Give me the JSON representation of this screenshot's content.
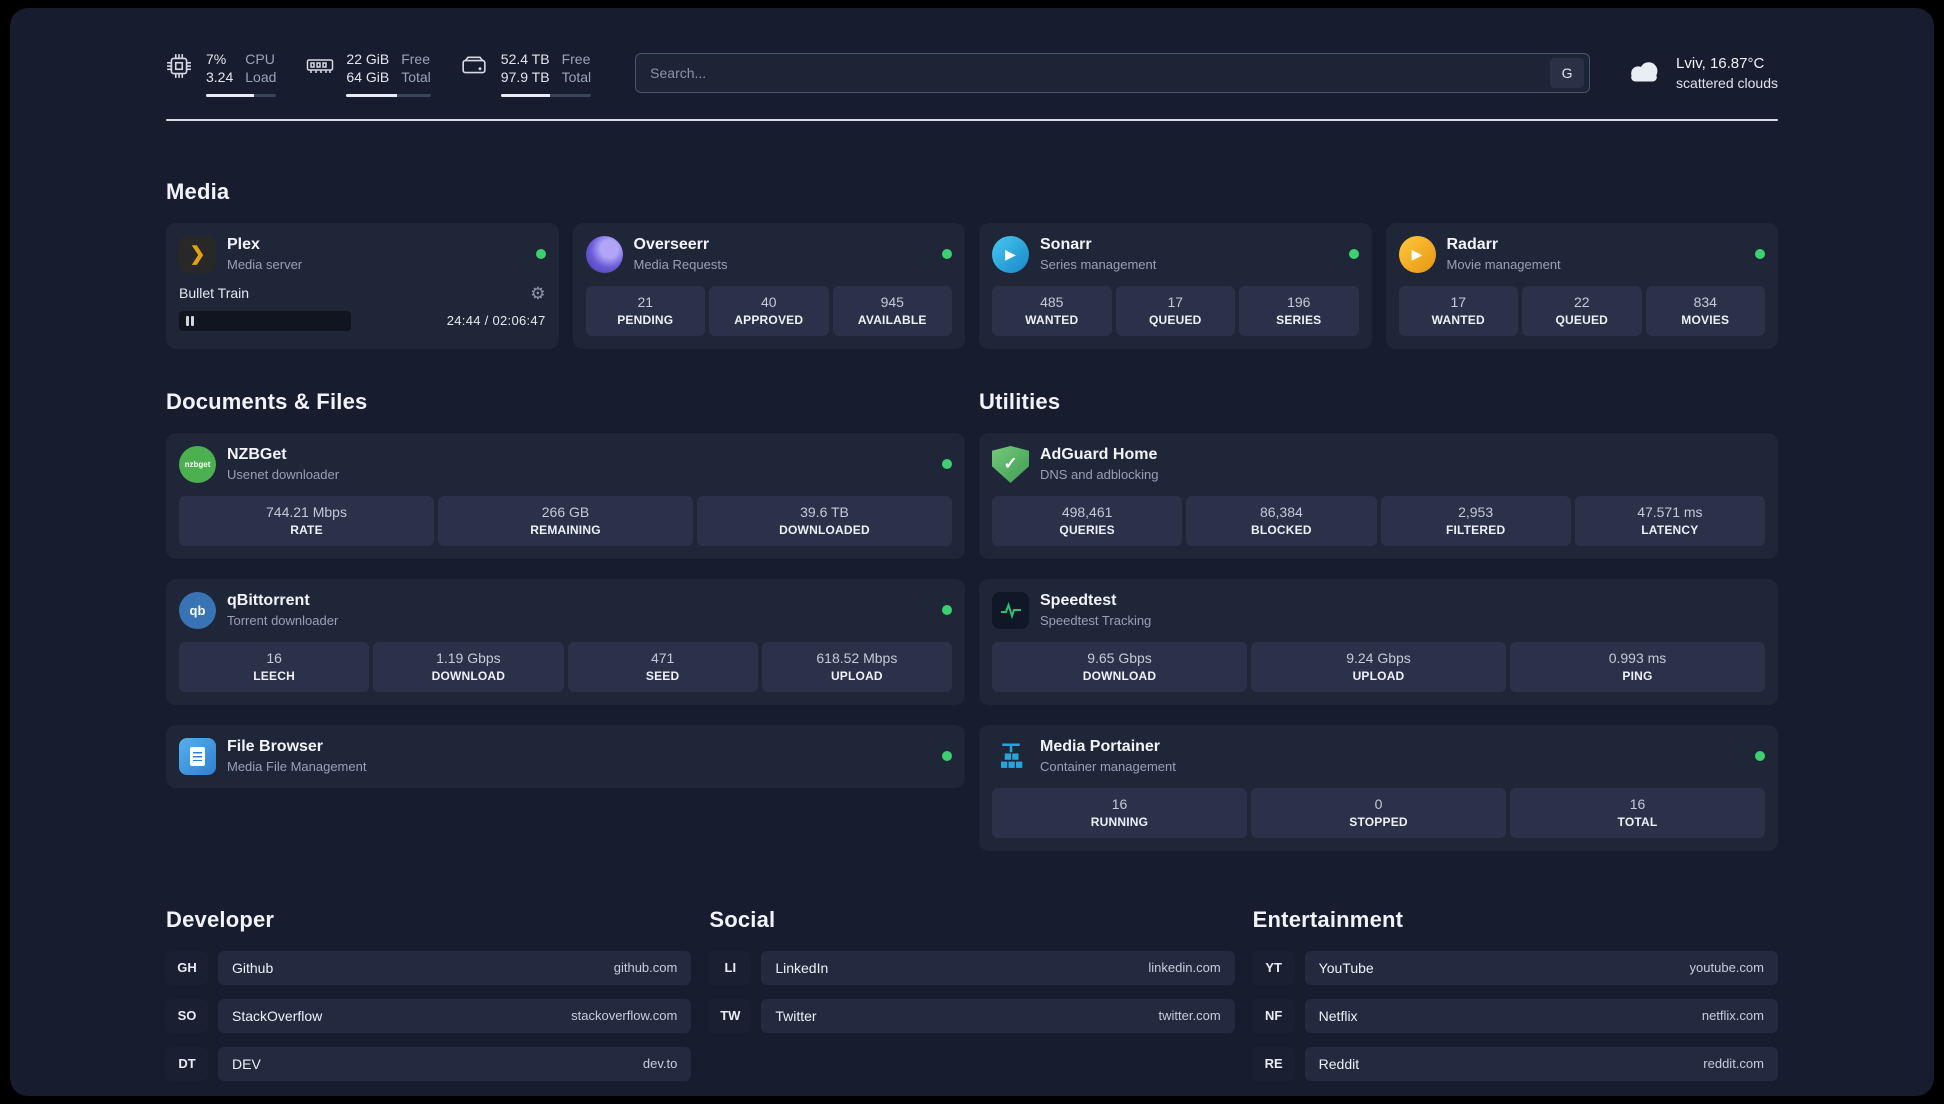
{
  "theme": {
    "page_bg": "#171c2e",
    "card_bg": "#1f2638",
    "tile_bg": "#2a3149",
    "status_green": "#3ecf70",
    "text_secondary": "#97a0b6",
    "divider": "#d7dbe4"
  },
  "topbar": {
    "cpu": {
      "value": "7%",
      "total": "3.24",
      "label_top": "CPU",
      "label_bottom": "Load"
    },
    "ram": {
      "value": "22 GiB",
      "total": "64 GiB",
      "label_top": "Free",
      "label_bottom": "Total"
    },
    "disk": {
      "value": "52.4 TB",
      "total": "97.9 TB",
      "label_top": "Free",
      "label_bottom": "Total"
    },
    "search": {
      "placeholder": "Search...",
      "engine_label": "G"
    },
    "weather": {
      "location": "Lviv, 16.87°C",
      "condition": "scattered clouds"
    }
  },
  "icons": {
    "plex": "❯",
    "sonarr": "▶",
    "radarr": "▶",
    "adguard_check": "✓",
    "qbittorrent_text": "qb",
    "nzbget_text": "nzbget",
    "gear": "⚙"
  },
  "sections": {
    "media": {
      "heading": "Media",
      "plex": {
        "name": "Plex",
        "subtitle": "Media server",
        "now_playing": "Bullet Train",
        "time": "24:44 / 02:06:47"
      },
      "overseerr": {
        "name": "Overseerr",
        "subtitle": "Media Requests",
        "stats": [
          {
            "value": "21",
            "label": "PENDING"
          },
          {
            "value": "40",
            "label": "APPROVED"
          },
          {
            "value": "945",
            "label": "AVAILABLE"
          }
        ]
      },
      "sonarr": {
        "name": "Sonarr",
        "subtitle": "Series management",
        "stats": [
          {
            "value": "485",
            "label": "WANTED"
          },
          {
            "value": "17",
            "label": "QUEUED"
          },
          {
            "value": "196",
            "label": "SERIES"
          }
        ]
      },
      "radarr": {
        "name": "Radarr",
        "subtitle": "Movie management",
        "stats": [
          {
            "value": "17",
            "label": "WANTED"
          },
          {
            "value": "22",
            "label": "QUEUED"
          },
          {
            "value": "834",
            "label": "MOVIES"
          }
        ]
      }
    },
    "documents": {
      "heading": "Documents & Files",
      "nzbget": {
        "name": "NZBGet",
        "subtitle": "Usenet downloader",
        "stats": [
          {
            "value": "744.21 Mbps",
            "label": "RATE"
          },
          {
            "value": "266 GB",
            "label": "REMAINING"
          },
          {
            "value": "39.6 TB",
            "label": "DOWNLOADED"
          }
        ]
      },
      "qbittorrent": {
        "name": "qBittorrent",
        "subtitle": "Torrent downloader",
        "stats": [
          {
            "value": "16",
            "label": "LEECH"
          },
          {
            "value": "1.19 Gbps",
            "label": "DOWNLOAD"
          },
          {
            "value": "471",
            "label": "SEED"
          },
          {
            "value": "618.52 Mbps",
            "label": "UPLOAD"
          }
        ]
      },
      "filebrowser": {
        "name": "File Browser",
        "subtitle": "Media File Management"
      }
    },
    "utilities": {
      "heading": "Utilities",
      "adguard": {
        "name": "AdGuard Home",
        "subtitle": "DNS and adblocking",
        "stats": [
          {
            "value": "498,461",
            "label": "QUERIES"
          },
          {
            "value": "86,384",
            "label": "BLOCKED"
          },
          {
            "value": "2,953",
            "label": "FILTERED"
          },
          {
            "value": "47.571 ms",
            "label": "LATENCY"
          }
        ]
      },
      "speedtest": {
        "name": "Speedtest",
        "subtitle": "Speedtest Tracking",
        "stats": [
          {
            "value": "9.65 Gbps",
            "label": "DOWNLOAD"
          },
          {
            "value": "9.24 Gbps",
            "label": "UPLOAD"
          },
          {
            "value": "0.993 ms",
            "label": "PING"
          }
        ]
      },
      "portainer": {
        "name": "Media Portainer",
        "subtitle": "Container management",
        "stats": [
          {
            "value": "16",
            "label": "RUNNING"
          },
          {
            "value": "0",
            "label": "STOPPED"
          },
          {
            "value": "16",
            "label": "TOTAL"
          }
        ]
      }
    },
    "links": {
      "developer": {
        "heading": "Developer",
        "items": [
          {
            "abbr": "GH",
            "name": "Github",
            "url": "github.com"
          },
          {
            "abbr": "SO",
            "name": "StackOverflow",
            "url": "stackoverflow.com"
          },
          {
            "abbr": "DT",
            "name": "DEV",
            "url": "dev.to"
          }
        ]
      },
      "social": {
        "heading": "Social",
        "items": [
          {
            "abbr": "LI",
            "name": "LinkedIn",
            "url": "linkedin.com"
          },
          {
            "abbr": "TW",
            "name": "Twitter",
            "url": "twitter.com"
          }
        ]
      },
      "entertainment": {
        "heading": "Entertainment",
        "items": [
          {
            "abbr": "YT",
            "name": "YouTube",
            "url": "youtube.com"
          },
          {
            "abbr": "NF",
            "name": "Netflix",
            "url": "netflix.com"
          },
          {
            "abbr": "RE",
            "name": "Reddit",
            "url": "reddit.com"
          }
        ]
      }
    }
  }
}
